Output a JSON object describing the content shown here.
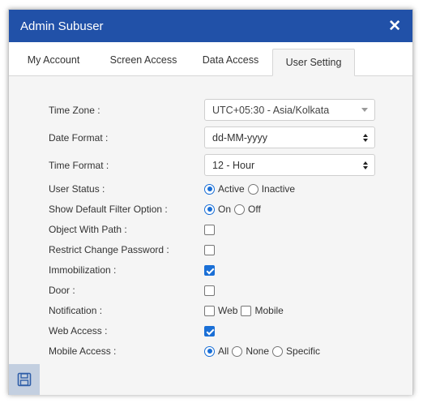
{
  "dialog": {
    "title": "Admin Subuser",
    "close_glyph": "✕"
  },
  "tabs": [
    {
      "label": "My Account",
      "active": false
    },
    {
      "label": "Screen Access",
      "active": false
    },
    {
      "label": "Data Access",
      "active": false
    },
    {
      "label": "User Setting",
      "active": true
    }
  ],
  "form": {
    "time_zone": {
      "label": "Time Zone :",
      "value": "UTC+05:30 - Asia/Kolkata"
    },
    "date_format": {
      "label": "Date Format :",
      "value": "dd-MM-yyyy"
    },
    "time_format": {
      "label": "Time Format :",
      "value": "12 - Hour"
    },
    "user_status": {
      "label": "User Status :",
      "options": [
        "Active",
        "Inactive"
      ],
      "selected": "Active"
    },
    "default_filter": {
      "label": "Show Default Filter Option :",
      "options": [
        "On",
        "Off"
      ],
      "selected": "On"
    },
    "object_with_path": {
      "label": "Object With Path :",
      "checked": false
    },
    "restrict_change_password": {
      "label": "Restrict Change Password :",
      "checked": false
    },
    "immobilization": {
      "label": "Immobilization :",
      "checked": true
    },
    "door": {
      "label": "Door :",
      "checked": false
    },
    "notification": {
      "label": "Notification :",
      "options": [
        {
          "label": "Web",
          "checked": false
        },
        {
          "label": "Mobile",
          "checked": false
        }
      ]
    },
    "web_access": {
      "label": "Web Access :",
      "checked": true
    },
    "mobile_access": {
      "label": "Mobile Access :",
      "options": [
        "All",
        "None",
        "Specific"
      ],
      "selected": "All"
    }
  },
  "footer": {
    "save_icon": "save-icon"
  },
  "colors": {
    "titlebar": "#2151a8",
    "accent": "#1a6fd6",
    "panel_bg": "#f5f5f5",
    "footer_bg": "#c3cfe0"
  }
}
